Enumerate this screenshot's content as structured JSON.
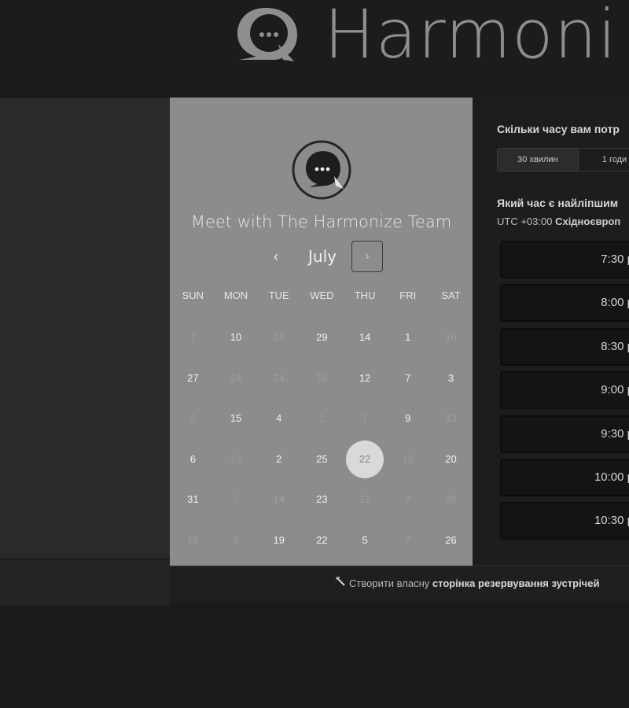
{
  "header": {
    "brand_name": "Harmoni",
    "logo_icon": "chat-bubble-logo"
  },
  "calendar": {
    "title": "Meet with The Harmonize Team",
    "month": "July",
    "prev_symbol": "‹",
    "next_symbol": "›",
    "weekdays": [
      "SUN",
      "MON",
      "TUE",
      "WED",
      "THU",
      "FRI",
      "SAT"
    ],
    "weeks": [
      [
        {
          "d": "7",
          "m": true
        },
        {
          "d": "10",
          "m": false
        },
        {
          "d": "14",
          "m": true
        },
        {
          "d": "29",
          "m": false
        },
        {
          "d": "14",
          "m": false
        },
        {
          "d": "1",
          "m": false
        },
        {
          "d": "16",
          "m": true
        }
      ],
      [
        {
          "d": "27",
          "m": false
        },
        {
          "d": "24",
          "m": true
        },
        {
          "d": "24",
          "m": true
        },
        {
          "d": "18",
          "m": true
        },
        {
          "d": "12",
          "m": false
        },
        {
          "d": "7",
          "m": false
        },
        {
          "d": "3",
          "m": false
        }
      ],
      [
        {
          "d": "2",
          "m": true
        },
        {
          "d": "15",
          "m": false
        },
        {
          "d": "4",
          "m": false
        },
        {
          "d": "1",
          "m": true
        },
        {
          "d": "7",
          "m": true
        },
        {
          "d": "9",
          "m": false
        },
        {
          "d": "13",
          "m": true
        }
      ],
      [
        {
          "d": "6",
          "m": false
        },
        {
          "d": "18",
          "m": true
        },
        {
          "d": "2",
          "m": false
        },
        {
          "d": "25",
          "m": false
        },
        {
          "d": "22",
          "m": false,
          "selected": true
        },
        {
          "d": "15",
          "m": true
        },
        {
          "d": "20",
          "m": false
        }
      ],
      [
        {
          "d": "31",
          "m": false
        },
        {
          "d": "7",
          "m": true
        },
        {
          "d": "14",
          "m": true
        },
        {
          "d": "23",
          "m": false
        },
        {
          "d": "21",
          "m": true
        },
        {
          "d": "7",
          "m": true
        },
        {
          "d": "20",
          "m": true
        }
      ],
      [
        {
          "d": "16",
          "m": true
        },
        {
          "d": "3",
          "m": true
        },
        {
          "d": "19",
          "m": false
        },
        {
          "d": "22",
          "m": false
        },
        {
          "d": "5",
          "m": false
        },
        {
          "d": "7",
          "m": true
        },
        {
          "d": "26",
          "m": false
        }
      ]
    ]
  },
  "booking": {
    "duration_question": "Скільки часу вам потр",
    "durations": [
      "30 хвилин",
      "1 годи"
    ],
    "time_question": "Який час є найліпшим",
    "timezone_prefix": "UTC +03:00",
    "timezone_name": "Східноєвроп",
    "slots": [
      "7:30 p",
      "8:00 p",
      "8:30 p",
      "9:00 p",
      "9:30 p",
      "10:00 p",
      "10:30 p"
    ]
  },
  "footer": {
    "icon": "wand-icon",
    "text_prefix": "Створити власну",
    "text_bold": "сторінка резервування зустрічей"
  },
  "colors": {
    "calendar_bg": "#8c8c8c",
    "page_bg": "#1b1b1b",
    "selected_day": "#d9d9d9"
  }
}
